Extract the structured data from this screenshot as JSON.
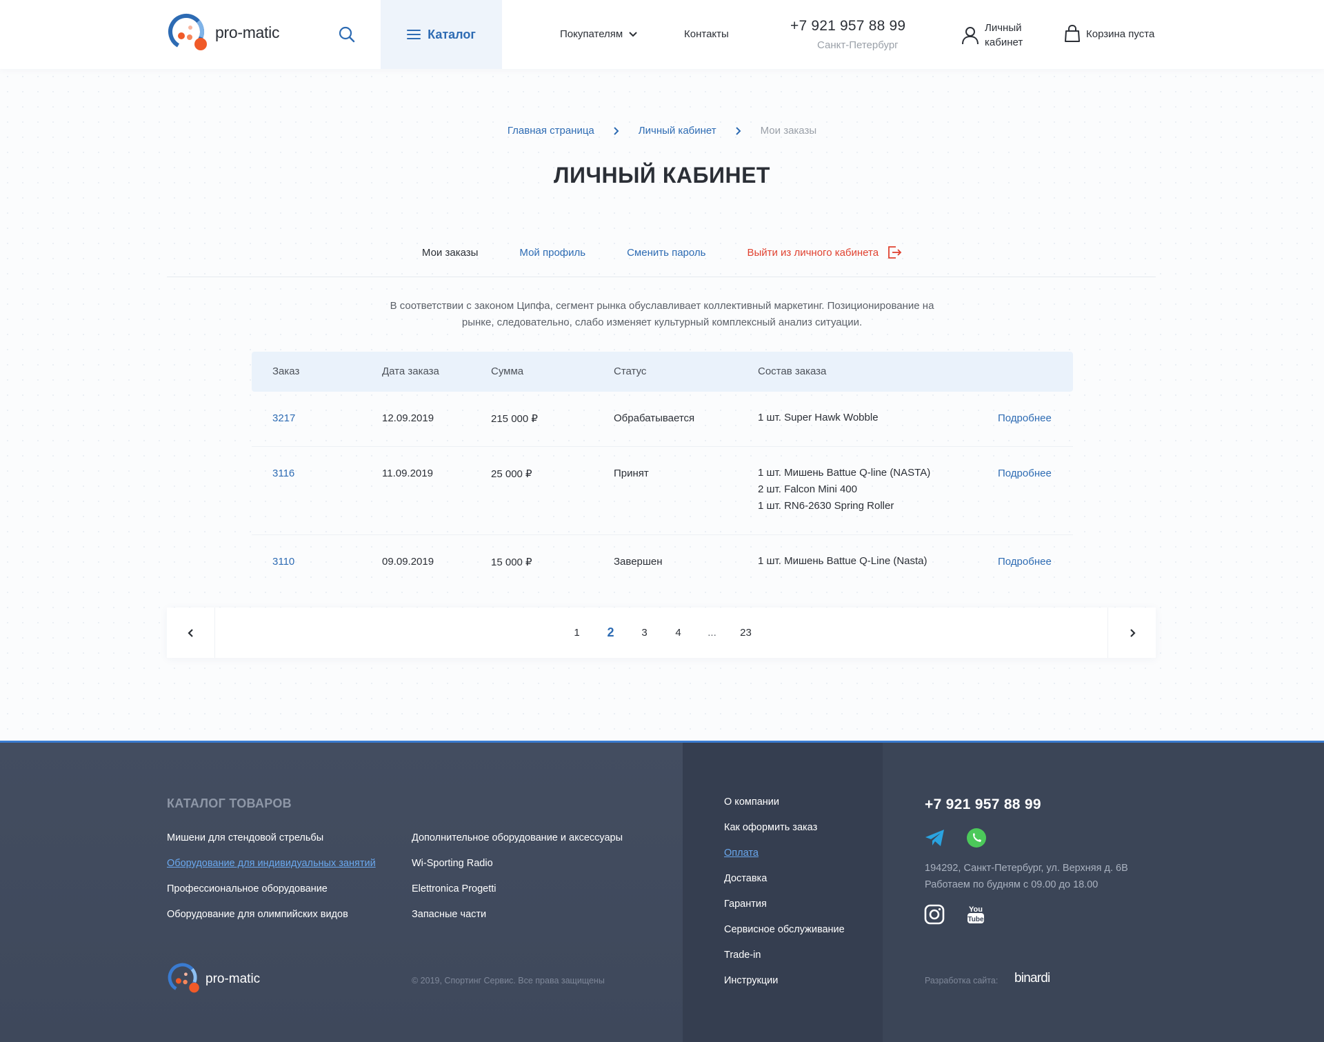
{
  "header": {
    "logo_text": "pro-matic",
    "catalog_label": "Каталог",
    "nav": {
      "buyers": "Покупателям",
      "contacts": "Контакты"
    },
    "phone": "+7 921 957 88 99",
    "city": "Санкт-Петербург",
    "account_label": "Личный кабинет",
    "cart_label": "Корзина пуста"
  },
  "breadcrumb": {
    "home": "Главная страница",
    "account": "Личный кабинет",
    "current": "Мои заказы"
  },
  "page_title": "ЛИЧНЫЙ КАБИНЕТ",
  "tabs": {
    "orders": "Мои заказы",
    "profile": "Мой профиль",
    "password": "Сменить пароль",
    "logout": "Выйти из личного кабинета"
  },
  "intro_text": "В соответствии с законом Ципфа, сегмент рынка обуславливает коллективный маркетинг. Позиционирование на рынке, следовательно, слабо изменяет культурный комплексный анализ ситуации.",
  "orders_table": {
    "columns": [
      "Заказ",
      "Дата заказа",
      "Сумма",
      "Статус",
      "Состав заказа"
    ],
    "rows": [
      {
        "id": "3217",
        "date": "12.09.2019",
        "sum": "215 000 ₽",
        "status": "Обрабатывается",
        "items": [
          "1 шт. Super Hawk Wobble"
        ],
        "details": "Подробнее"
      },
      {
        "id": "3116",
        "date": "11.09.2019",
        "sum": "25 000 ₽",
        "status": "Принят",
        "items": [
          "1 шт. Мишень Battue Q-line (NASTA)",
          "2 шт. Falcon Mini 400",
          "1 шт. RN6-2630 Spring Roller"
        ],
        "details": "Подробнее"
      },
      {
        "id": "3110",
        "date": "09.09.2019",
        "sum": "15 000 ₽",
        "status": "Завершен",
        "items": [
          "1 шт. Мишень Battue Q-Line (Nasta)"
        ],
        "details": "Подробнее"
      }
    ]
  },
  "pagination": {
    "pages": [
      "1",
      "2",
      "3",
      "4",
      "...",
      "23"
    ],
    "current": "2"
  },
  "footer": {
    "catalog_title": "КАТАЛОГ ТОВАРОВ",
    "catalog_col1": [
      "Мишени для стендовой стрельбы",
      "Оборудование для индивидуальных занятий",
      "Профессиональное оборудование",
      "Оборудование для олимпийских видов"
    ],
    "catalog_col2": [
      "Дополнительное оборудование и аксессуары",
      "Wi-Sporting Radio",
      "Elettronica Progetti",
      "Запасные части"
    ],
    "active_catalog_link": "Оборудование для индивидуальных занятий",
    "info_links": [
      "О компании",
      "Как оформить заказ",
      "Оплата",
      "Доставка",
      "Гарантия",
      "Сервисное обслуживание",
      "Trade-in",
      "Инструкции"
    ],
    "active_info_link": "Оплата",
    "logo_text": "pro-matic",
    "copyright": "© 2019, Спортинг Сервис. Все права защищены",
    "phone": "+7 921 957 88 99",
    "address": "194292, Санкт-Петербург, ул. Верхняя д. 6В",
    "hours": "Работаем по будням с 09.00 до 18.00",
    "dev_label": "Разработка сайта:",
    "dev_brand": "binardi",
    "youtube_text_top": "You",
    "youtube_text_bottom": "Tube"
  },
  "colors": {
    "accent": "#2d6bb3",
    "logout_red": "#e0412f",
    "footer_bg": "#414b5e",
    "telegram": "#2aa3e0",
    "whatsapp": "#4cc95a",
    "logo_orange": "#f05a28"
  },
  "icons": {
    "search": "search-icon",
    "burger": "burger-icon",
    "chevron_down": "chevron-down-icon",
    "user": "user-icon",
    "cart": "shopping-bag-icon",
    "logout": "logout-icon",
    "telegram": "telegram-icon",
    "whatsapp": "whatsapp-icon",
    "instagram": "instagram-icon",
    "youtube": "youtube-icon"
  }
}
